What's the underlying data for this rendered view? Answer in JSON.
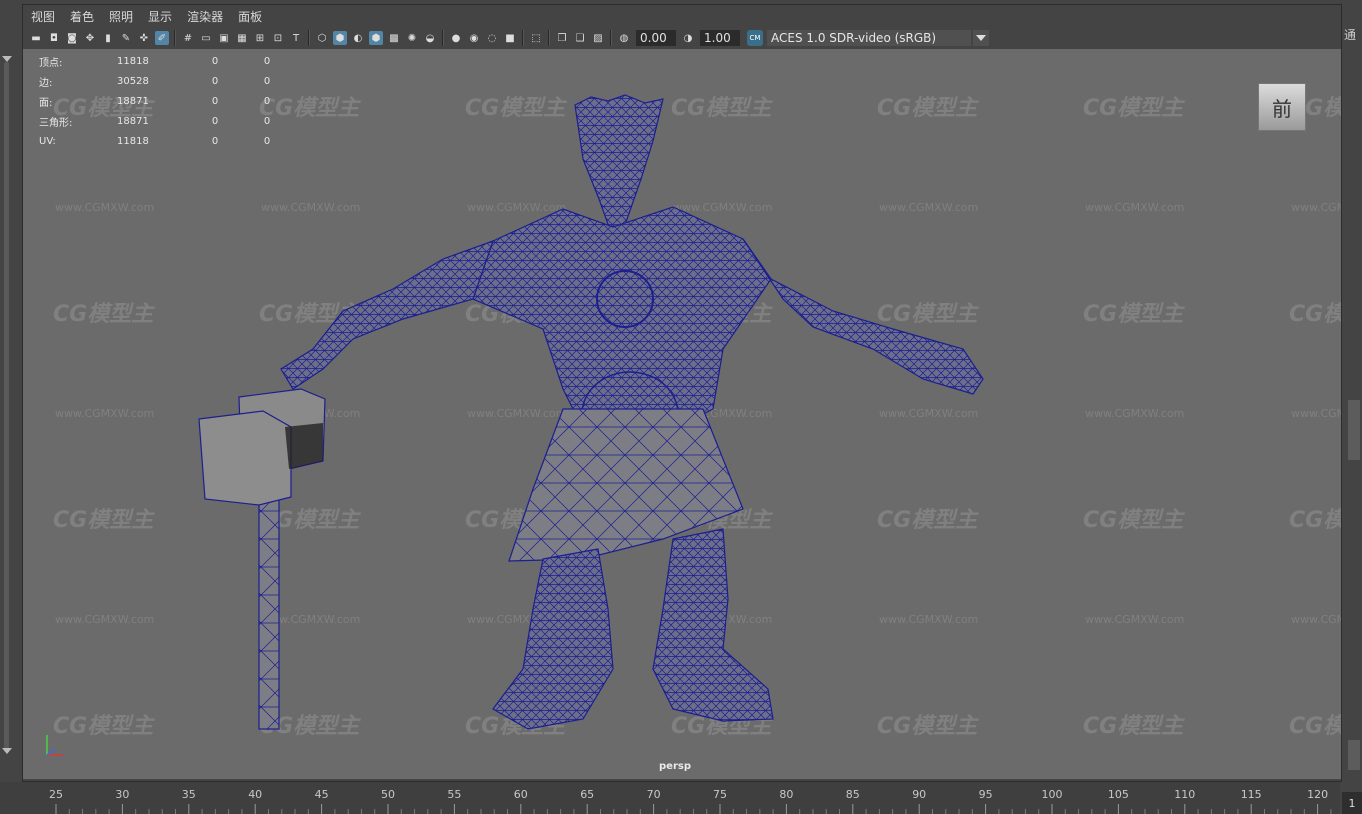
{
  "menubar": {
    "items": [
      "视图",
      "着色",
      "照明",
      "显示",
      "渲染器",
      "面板"
    ]
  },
  "toolbar": {
    "exposure_value": "0.00",
    "gamma_value": "1.00",
    "colorspace_badge": "CM",
    "colorspace": "ACES 1.0 SDR-video (sRGB)"
  },
  "hud": {
    "rows": [
      {
        "label": "顶点:",
        "v1": "11818",
        "v2": "0",
        "v3": "0"
      },
      {
        "label": "边:",
        "v1": "30528",
        "v2": "0",
        "v3": "0"
      },
      {
        "label": "面:",
        "v1": "18871",
        "v2": "0",
        "v3": "0"
      },
      {
        "label": "三角形:",
        "v1": "18871",
        "v2": "0",
        "v3": "0"
      },
      {
        "label": "UV:",
        "v1": "11818",
        "v2": "0",
        "v3": "0"
      }
    ]
  },
  "view_cube": {
    "label": "前"
  },
  "camera": {
    "label": "persp"
  },
  "watermark": {
    "logo": "CG模型主",
    "url": "www.CGMXW.com"
  },
  "timeline": {
    "ticks": [
      "25",
      "30",
      "35",
      "40",
      "45",
      "50",
      "55",
      "60",
      "65",
      "70",
      "75",
      "80",
      "85",
      "90",
      "95",
      "100",
      "105",
      "110",
      "115",
      "120"
    ],
    "current_frame": "1"
  },
  "right_edge": {
    "text": "通"
  },
  "colors": {
    "viewport_bg": "#6b6b6b",
    "wire": "#1b1f8f",
    "ui_bg": "#444444",
    "highlight": "#5285a6"
  }
}
